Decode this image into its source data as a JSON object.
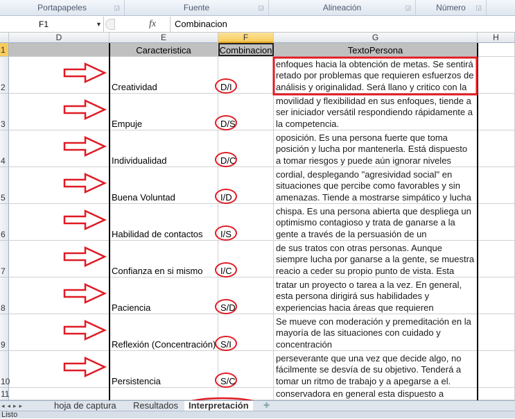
{
  "ribbon": {
    "groups": [
      "Portapapeles",
      "Fuente",
      "Alineación",
      "Número"
    ]
  },
  "formula_bar": {
    "name_box": "F1",
    "fx_label": "fx",
    "value": "Combinacion"
  },
  "columns": [
    "D",
    "E",
    "F",
    "G",
    "H"
  ],
  "selected_column": "F",
  "header_row": {
    "num": "1",
    "caracteristica": "Caracteristica",
    "combinacion": "Combinacion",
    "texto": "TextoPersona"
  },
  "rows": [
    {
      "num": "2",
      "caracteristica": "Creatividad",
      "combinacion": "D/I",
      "texto": [
        "enfoques hacia la obtención de metas. Se sentirá",
        "retado por problemas que requieren esfuerzos de",
        "análisis y originalidad. Será llano y critico con la"
      ]
    },
    {
      "num": "3",
      "caracteristica": "Empuje",
      "combinacion": "D/S",
      "texto": [
        "movilidad y flexibilidad en sus enfoques, tiende a",
        "ser iniciador versátil respondiendo rápidamente a",
        "la competencia."
      ]
    },
    {
      "num": "4",
      "caracteristica": "Individualidad",
      "combinacion": "D/C",
      "texto": [
        "oposición. Es una persona fuerte que toma",
        "posición y lucha por mantenerla. Está dispuesto",
        "a tomar riesgos y puede aún ignorar niveles"
      ]
    },
    {
      "num": "5",
      "caracteristica": "Buena Voluntad",
      "combinacion": "I/D",
      "texto": [
        "cordial, desplegando \"agresividad social\" en",
        "situaciones que percibe como favorables y sin",
        "amenazas. Tiende a mostrarse simpático y lucha"
      ]
    },
    {
      "num": "6",
      "caracteristica": "Habilidad de contactos",
      "combinacion": "I/S",
      "texto": [
        "chispa. Es una persona abierta que despliega un",
        "optimismo contagioso y trata de ganarse a la",
        "gente a través de la persuasión de un"
      ]
    },
    {
      "num": "7",
      "caracteristica": "Confianza en si mismo",
      "combinacion": "I/C",
      "texto": [
        "de sus tratos con otras personas. Aunque",
        "siempre lucha por ganarse a la gente, se muestra",
        "reacio a ceder su propio punto de vista. Esta"
      ]
    },
    {
      "num": "8",
      "caracteristica": "Paciencia",
      "combinacion": "S/D",
      "texto": [
        "tratar un proyecto o tarea a la vez. En general,",
        "esta persona dirigirá sus habilidades y",
        "experiencias hacia áreas que requieren"
      ]
    },
    {
      "num": "9",
      "caracteristica": "Reflexión (Concentración)",
      "combinacion": "S/I",
      "texto": [
        "Se mueve con moderación y premeditación en la",
        "mayoría de las situaciones con cuidado y",
        "concentración"
      ]
    },
    {
      "num": "10",
      "caracteristica": "Persistencia",
      "combinacion": "S/C",
      "texto": [
        "perseverante que una vez que decide algo, no",
        "fácilmente se desvía de su objetivo. Tenderá a",
        "tomar un ritmo de trabajo y a apegarse a el."
      ]
    },
    {
      "num": "11",
      "caracteristica": "",
      "combinacion": "",
      "texto": [
        "conservadora en general esta dispuesto a"
      ]
    }
  ],
  "sheet_tabs": [
    "hoja de captura",
    "Resultados",
    "Interpretación"
  ],
  "active_tab": "Interpretación",
  "status": "Listo",
  "annotation_color": "#e01b24"
}
